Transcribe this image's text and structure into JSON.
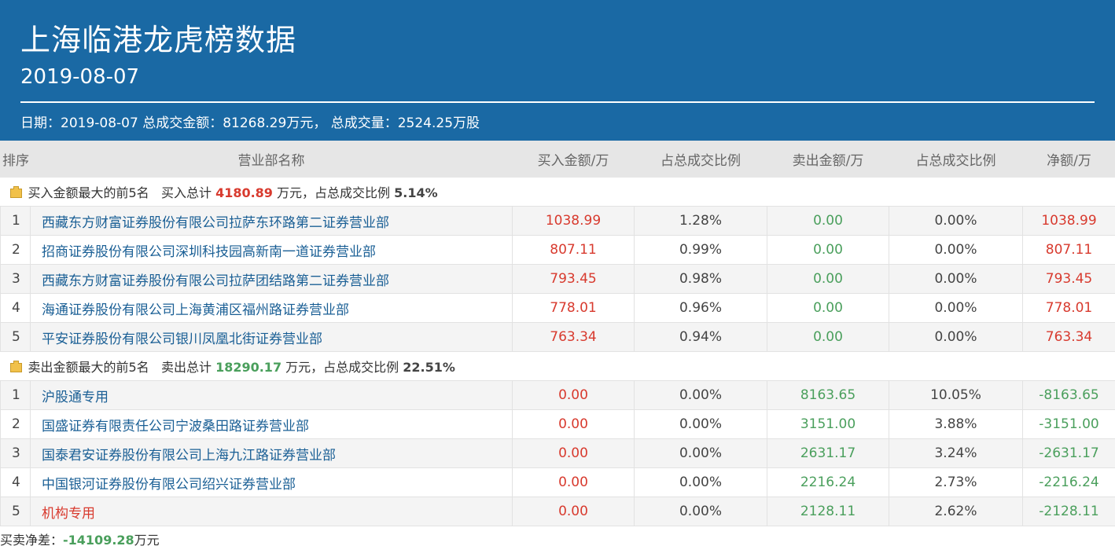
{
  "header": {
    "title": "上海临港龙虎榜数据",
    "date": "2019-08-07",
    "info": "日期：2019-08-07 总成交金额：81268.29万元， 总成交量：2524.25万股"
  },
  "columns": [
    "排序",
    "营业部名称",
    "买入金额/万",
    "占总成交比例",
    "卖出金额/万",
    "占总成交比例",
    "净额/万"
  ],
  "buy_section": {
    "label": "买入金额最大的前5名",
    "total_prefix": "买入总计",
    "total": "4180.89",
    "total_unit": "万元，占总成交比例",
    "ratio": "5.14%"
  },
  "buy_rows": [
    {
      "rank": "1",
      "name": "西藏东方财富证券股份有限公司拉萨东环路第二证券营业部",
      "buy": "1038.99",
      "buy_pct": "1.28%",
      "sell": "0.00",
      "sell_pct": "0.00%",
      "net": "1038.99"
    },
    {
      "rank": "2",
      "name": "招商证券股份有限公司深圳科技园高新南一道证券营业部",
      "buy": "807.11",
      "buy_pct": "0.99%",
      "sell": "0.00",
      "sell_pct": "0.00%",
      "net": "807.11"
    },
    {
      "rank": "3",
      "name": "西藏东方财富证券股份有限公司拉萨团结路第二证券营业部",
      "buy": "793.45",
      "buy_pct": "0.98%",
      "sell": "0.00",
      "sell_pct": "0.00%",
      "net": "793.45"
    },
    {
      "rank": "4",
      "name": "海通证券股份有限公司上海黄浦区福州路证券营业部",
      "buy": "778.01",
      "buy_pct": "0.96%",
      "sell": "0.00",
      "sell_pct": "0.00%",
      "net": "778.01"
    },
    {
      "rank": "5",
      "name": "平安证券股份有限公司银川凤凰北街证券营业部",
      "buy": "763.34",
      "buy_pct": "0.94%",
      "sell": "0.00",
      "sell_pct": "0.00%",
      "net": "763.34"
    }
  ],
  "sell_section": {
    "label": "卖出金额最大的前5名",
    "total_prefix": "卖出总计",
    "total": "18290.17",
    "total_unit": "万元，占总成交比例",
    "ratio": "22.51%"
  },
  "sell_rows": [
    {
      "rank": "1",
      "name": "沪股通专用",
      "buy": "0.00",
      "buy_pct": "0.00%",
      "sell": "8163.65",
      "sell_pct": "10.05%",
      "net": "-8163.65"
    },
    {
      "rank": "2",
      "name": "国盛证券有限责任公司宁波桑田路证券营业部",
      "buy": "0.00",
      "buy_pct": "0.00%",
      "sell": "3151.00",
      "sell_pct": "3.88%",
      "net": "-3151.00"
    },
    {
      "rank": "3",
      "name": "国泰君安证券股份有限公司上海九江路证券营业部",
      "buy": "0.00",
      "buy_pct": "0.00%",
      "sell": "2631.17",
      "sell_pct": "3.24%",
      "net": "-2631.17"
    },
    {
      "rank": "4",
      "name": "中国银河证券股份有限公司绍兴证券营业部",
      "buy": "0.00",
      "buy_pct": "0.00%",
      "sell": "2216.24",
      "sell_pct": "2.73%",
      "net": "-2216.24"
    },
    {
      "rank": "5",
      "name": "机构专用",
      "buy": "0.00",
      "buy_pct": "0.00%",
      "sell": "2128.11",
      "sell_pct": "2.62%",
      "net": "-2128.11"
    }
  ],
  "footer": {
    "label": "买卖净差：",
    "value": "-14109.28",
    "unit": "万元"
  },
  "colors": {
    "header_bg": "#1a69a4",
    "buy_red": "#d83a2e",
    "sell_green": "#4a9f5c",
    "link_blue": "#1a5f95"
  }
}
